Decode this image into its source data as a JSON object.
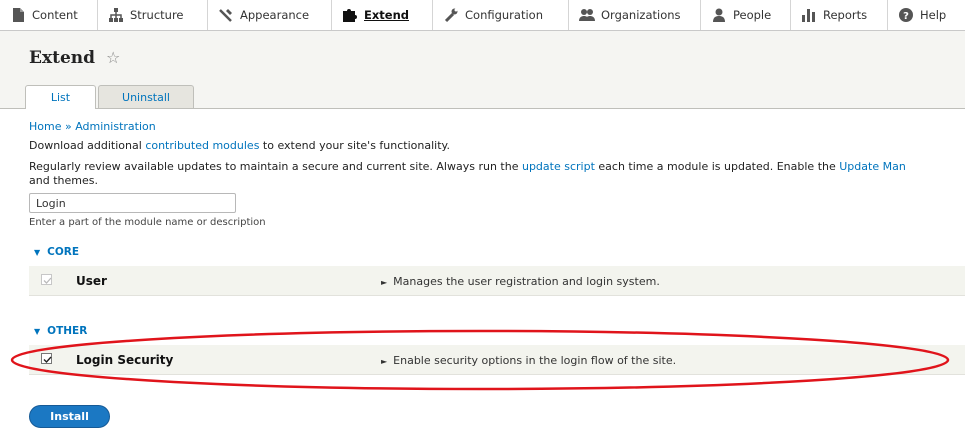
{
  "toolbar": {
    "items": [
      {
        "label": "Content",
        "icon": "page-icon"
      },
      {
        "label": "Structure",
        "icon": "sitemap-icon"
      },
      {
        "label": "Appearance",
        "icon": "wrench-brush-icon"
      },
      {
        "label": "Extend",
        "icon": "puzzle-icon",
        "active": true
      },
      {
        "label": "Configuration",
        "icon": "wrench-icon"
      },
      {
        "label": "Organizations",
        "icon": "group-icon"
      },
      {
        "label": "People",
        "icon": "person-icon"
      },
      {
        "label": "Reports",
        "icon": "bar-chart-icon"
      },
      {
        "label": "Help",
        "icon": "help-icon"
      }
    ]
  },
  "page": {
    "title": "Extend",
    "tabs": [
      {
        "label": "List",
        "active": true
      },
      {
        "label": "Uninstall"
      }
    ]
  },
  "breadcrumb": {
    "home": "Home",
    "sep": " » ",
    "admin": "Administration"
  },
  "intro": {
    "line1_pre": "Download additional ",
    "line1_link": "contributed modules",
    "line1_post": " to extend your site's functionality.",
    "line2_pre": "Regularly review available updates to maintain a secure and current site. Always run the ",
    "line2_link": "update script",
    "line2_mid": " each time a module is updated. Enable the ",
    "line2_link2": "Update Man",
    "line3": "and themes."
  },
  "filter": {
    "value": "Login",
    "help": "Enter a part of the module name or description"
  },
  "groups": [
    {
      "name": "CORE",
      "modules": [
        {
          "name": "User",
          "description": "Manages the user registration and login system.",
          "checked": true,
          "disabled": true
        }
      ]
    },
    {
      "name": "OTHER",
      "modules": [
        {
          "name": "Login Security",
          "description": "Enable security options in the login flow of the site.",
          "checked": true,
          "disabled": false
        }
      ]
    }
  ],
  "install_label": "Install",
  "colors": {
    "link": "#0074bd",
    "button": "#1b78c3",
    "highlight": "#e0141b"
  }
}
